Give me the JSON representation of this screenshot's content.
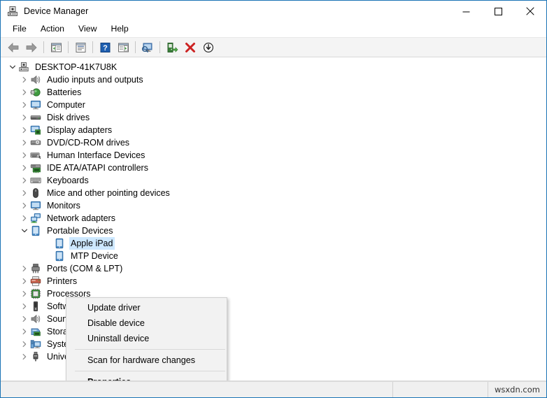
{
  "window": {
    "title": "Device Manager",
    "icon": "device-manager-icon",
    "border_color": "#1a73b5",
    "controls": [
      {
        "name": "minimize-button",
        "glyph": "minimize"
      },
      {
        "name": "maximize-button",
        "glyph": "maximize"
      },
      {
        "name": "close-button",
        "glyph": "close"
      }
    ]
  },
  "menubar": {
    "items": [
      {
        "label": "File",
        "name": "menu-file"
      },
      {
        "label": "Action",
        "name": "menu-action"
      },
      {
        "label": "View",
        "name": "menu-view"
      },
      {
        "label": "Help",
        "name": "menu-help"
      }
    ]
  },
  "toolbar": {
    "buttons": [
      {
        "name": "back-button",
        "icon": "back-arrow-icon"
      },
      {
        "name": "forward-button",
        "icon": "forward-arrow-icon"
      },
      {
        "name": "separator-1",
        "icon": "separator"
      },
      {
        "name": "show-hide-console-tree-button",
        "icon": "console-tree-icon"
      },
      {
        "name": "separator-2",
        "icon": "separator"
      },
      {
        "name": "properties-button",
        "icon": "properties-icon"
      },
      {
        "name": "separator-3",
        "icon": "separator"
      },
      {
        "name": "help-button",
        "icon": "help-question-icon"
      },
      {
        "name": "show-hide-action-pane-button",
        "icon": "action-pane-icon"
      },
      {
        "name": "separator-4",
        "icon": "separator"
      },
      {
        "name": "scan-for-hardware-changes-button",
        "icon": "scan-hardware-icon"
      },
      {
        "name": "separator-5",
        "icon": "separator"
      },
      {
        "name": "update-driver-button",
        "icon": "update-driver-icon"
      },
      {
        "name": "uninstall-device-button",
        "icon": "uninstall-red-x-icon"
      },
      {
        "name": "disable-device-button",
        "icon": "disable-device-down-arrow-icon"
      }
    ]
  },
  "tree": {
    "nodes": [
      {
        "label": "DESKTOP-41K7U8K",
        "level": 0,
        "expander": "expanded",
        "icon": "computer-root-icon",
        "selected": false
      },
      {
        "label": "Audio inputs and outputs",
        "level": 1,
        "expander": "collapsed",
        "icon": "speaker-icon",
        "selected": false
      },
      {
        "label": "Batteries",
        "level": 1,
        "expander": "collapsed",
        "icon": "battery-icon",
        "selected": false
      },
      {
        "label": "Computer",
        "level": 1,
        "expander": "collapsed",
        "icon": "monitor-icon",
        "selected": false
      },
      {
        "label": "Disk drives",
        "level": 1,
        "expander": "collapsed",
        "icon": "disk-drive-icon",
        "selected": false
      },
      {
        "label": "Display adapters",
        "level": 1,
        "expander": "collapsed",
        "icon": "display-adapter-icon",
        "selected": false
      },
      {
        "label": "DVD/CD-ROM drives",
        "level": 1,
        "expander": "collapsed",
        "icon": "optical-drive-icon",
        "selected": false
      },
      {
        "label": "Human Interface Devices",
        "level": 1,
        "expander": "collapsed",
        "icon": "hid-icon",
        "selected": false
      },
      {
        "label": "IDE ATA/ATAPI controllers",
        "level": 1,
        "expander": "collapsed",
        "icon": "ide-controller-icon",
        "selected": false
      },
      {
        "label": "Keyboards",
        "level": 1,
        "expander": "collapsed",
        "icon": "keyboard-icon",
        "selected": false
      },
      {
        "label": "Mice and other pointing devices",
        "level": 1,
        "expander": "collapsed",
        "icon": "mouse-icon",
        "selected": false
      },
      {
        "label": "Monitors",
        "level": 1,
        "expander": "collapsed",
        "icon": "monitor-icon",
        "selected": false
      },
      {
        "label": "Network adapters",
        "level": 1,
        "expander": "collapsed",
        "icon": "network-adapter-icon",
        "selected": false
      },
      {
        "label": "Portable Devices",
        "level": 1,
        "expander": "expanded",
        "icon": "portable-device-icon",
        "selected": false
      },
      {
        "label": "Apple iPad",
        "level": 2,
        "expander": "none",
        "icon": "portable-device-icon",
        "selected": true
      },
      {
        "label": "MTP Device",
        "level": 2,
        "expander": "none",
        "icon": "portable-device-icon",
        "selected": false
      },
      {
        "label": "Ports (COM & LPT)",
        "level": 1,
        "expander": "collapsed",
        "icon": "port-icon",
        "selected": false
      },
      {
        "label": "Printers",
        "level": 1,
        "expander": "collapsed",
        "icon": "printer-icon",
        "selected": false
      },
      {
        "label": "Processors",
        "level": 1,
        "expander": "collapsed",
        "icon": "processor-icon",
        "selected": false
      },
      {
        "label": "Software devices",
        "level": 1,
        "expander": "collapsed",
        "icon": "software-device-icon",
        "selected": false
      },
      {
        "label": "Sound, video and game controllers",
        "level": 1,
        "expander": "collapsed",
        "icon": "speaker-icon",
        "selected": false
      },
      {
        "label": "Storage controllers",
        "level": 1,
        "expander": "collapsed",
        "icon": "storage-controller-icon",
        "selected": false
      },
      {
        "label": "System devices",
        "level": 1,
        "expander": "collapsed",
        "icon": "system-device-icon",
        "selected": false
      },
      {
        "label": "Universal Serial Bus controllers",
        "level": 1,
        "expander": "collapsed",
        "icon": "usb-icon",
        "selected": false
      }
    ]
  },
  "context_menu": {
    "items": [
      {
        "label": "Update driver",
        "name": "ctx-update-driver",
        "bold": false,
        "separator_after": false
      },
      {
        "label": "Disable device",
        "name": "ctx-disable-device",
        "bold": false,
        "separator_after": false
      },
      {
        "label": "Uninstall device",
        "name": "ctx-uninstall-device",
        "bold": false,
        "separator_after": true
      },
      {
        "label": "Scan for hardware changes",
        "name": "ctx-scan-hardware-changes",
        "bold": false,
        "separator_after": true
      },
      {
        "label": "Properties",
        "name": "ctx-properties",
        "bold": true,
        "separator_after": false
      }
    ]
  },
  "statusbar": {
    "pane1": "",
    "pane2": "",
    "watermark": "wsxdn.com"
  },
  "colors": {
    "selection": "#cde8ff",
    "titlebar_border": "#1a73b5",
    "toolbar_bg": "#f4f4f4",
    "menu_bg": "#f2f2f2",
    "statusbar_bg": "#f0f0f0"
  }
}
